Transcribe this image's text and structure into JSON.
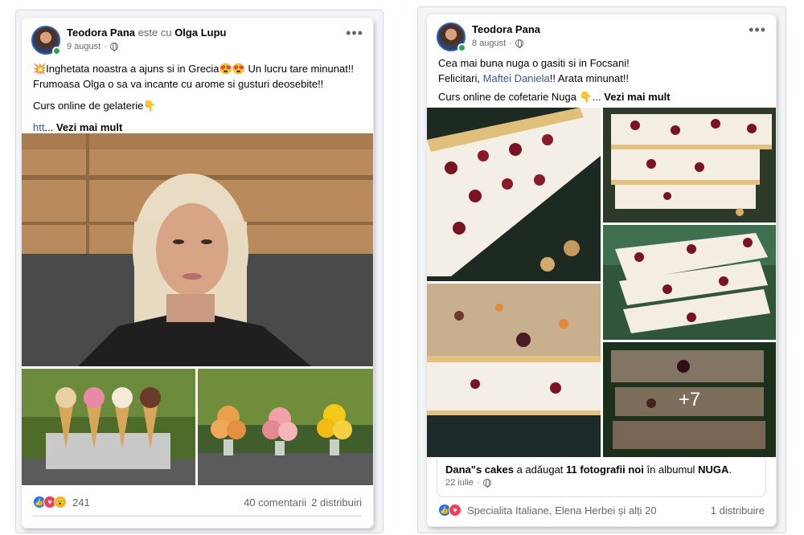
{
  "post1": {
    "author": "Teodora Pana",
    "with_text": "este cu",
    "tagged": "Olga Lupu",
    "date": "9 august",
    "line1": "💥Inghetata noastra a ajuns si in Grecia😍😍 Un lucru tare minunat!!",
    "line2": "Frumoasa Olga o sa va incante cu arome si gusturi deosebite!!",
    "line3": "Curs online de gelaterie👇",
    "link_stub": "htt",
    "ellipsis": "...",
    "see_more": "Vezi mai mult",
    "reactions_count": "241",
    "comments": "40 comentarii",
    "shares": "2 distribuiri"
  },
  "post2": {
    "author": "Teodora Pana",
    "date": "8 august",
    "line1": "Cea mai buna nuga o gasiti si in Focsani!",
    "line2_pre": "Felicitari,",
    "line2_mention": "Maftei Daniela",
    "line2_post": "!! Arata minunat!!",
    "line3": "Curs online de cofetarie Nuga 👇...",
    "see_more": "Vezi mai mult",
    "more_photos": "+7",
    "album_author": "Dana\"s cakes",
    "album_text": "a adăugat",
    "album_count": "11 fotografii noi",
    "album_in": "în albumul",
    "album_name": "NUGA",
    "album_date": "22 iulie",
    "reactions_names": "Specialita Italiane, Elena Herbei și alți 20",
    "shares": "1 distribuire"
  },
  "icons": {
    "more": "more-dots-icon",
    "globe": "globe-icon",
    "like": "like-reaction-icon",
    "love": "love-reaction-icon",
    "wow": "wow-reaction-icon"
  }
}
